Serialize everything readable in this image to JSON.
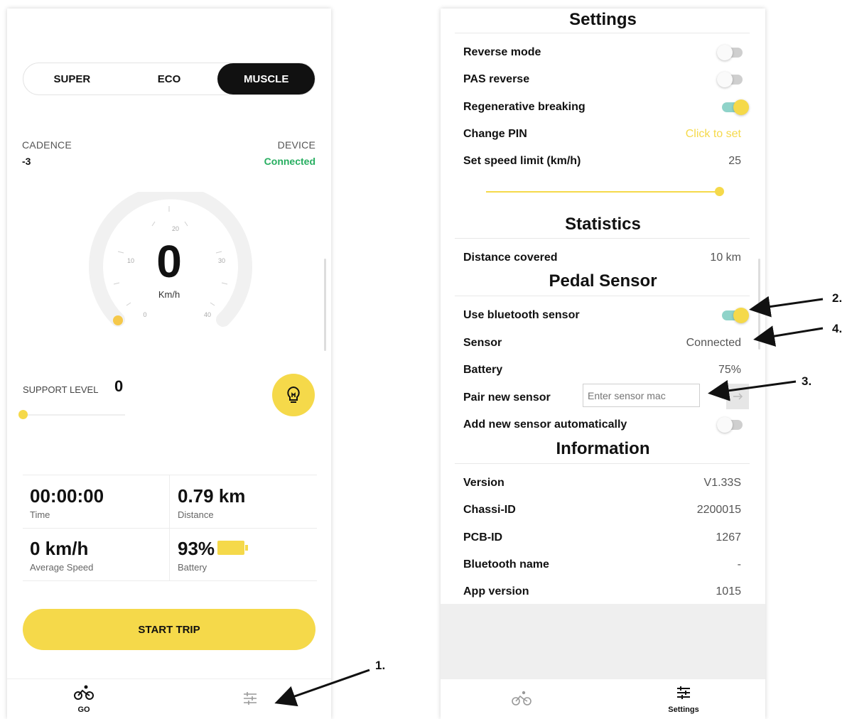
{
  "go_screen": {
    "modes": [
      {
        "label": "SUPER",
        "active": false
      },
      {
        "label": "ECO",
        "active": false
      },
      {
        "label": "MUSCLE",
        "active": true
      }
    ],
    "cadence": {
      "label": "CADENCE",
      "value": "-3"
    },
    "device": {
      "label": "DEVICE",
      "value": "Connected",
      "color": "#27ae60"
    },
    "speedometer": {
      "speed": "0",
      "unit": "Km/h",
      "ticks": [
        "0",
        "10",
        "20",
        "30",
        "40"
      ],
      "level_fraction": 0
    },
    "support_level": {
      "label": "SUPPORT LEVEL",
      "value": "0",
      "level_fraction": 0
    },
    "light_button": {
      "icon": "lightbulb-icon"
    },
    "stats": {
      "time": {
        "value": "00:00:00",
        "label": "Time"
      },
      "distance": {
        "value": "0.79 km",
        "label": "Distance"
      },
      "avg_speed": {
        "value": "0 km/h",
        "label": "Average Speed"
      },
      "battery": {
        "value": "93%",
        "label": "Battery",
        "icon": "battery-icon"
      }
    },
    "start_button": "START TRIP",
    "nav": {
      "go": {
        "label": "GO",
        "icon": "bicycle-icon"
      },
      "settings": {
        "label": "",
        "icon": "sliders-icon"
      }
    }
  },
  "settings_screen": {
    "title": "Settings",
    "settings": {
      "reverse_mode": {
        "label": "Reverse mode",
        "on": false
      },
      "pas_reverse": {
        "label": "PAS reverse",
        "on": false
      },
      "regen": {
        "label": "Regenerative breaking",
        "on": true
      },
      "change_pin": {
        "label": "Change PIN",
        "value": "Click to set"
      },
      "speed_limit": {
        "label": "Set speed limit (km/h)",
        "value": "25",
        "slider_fraction": 1.0
      }
    },
    "statistics": {
      "title": "Statistics",
      "distance": {
        "label": "Distance covered",
        "value": "10 km"
      }
    },
    "pedal_sensor": {
      "title": "Pedal Sensor",
      "use_bluetooth": {
        "label": "Use bluetooth sensor",
        "on": true
      },
      "sensor": {
        "label": "Sensor",
        "value": "Connected"
      },
      "battery": {
        "label": "Battery",
        "value": "75%"
      },
      "pair": {
        "label": "Pair new sensor",
        "placeholder": "Enter sensor mac",
        "button_icon": "arrow-right-icon"
      },
      "auto_add": {
        "label": "Add new sensor automatically",
        "on": false
      }
    },
    "information": {
      "title": "Information",
      "version": {
        "label": "Version",
        "value": "V1.33S"
      },
      "chassi": {
        "label": "Chassi-ID",
        "value": "2200015"
      },
      "pcb": {
        "label": "PCB-ID",
        "value": "1267"
      },
      "bt_name": {
        "label": "Bluetooth name",
        "value": "-"
      },
      "app_version": {
        "label": "App version",
        "value": "1015"
      }
    },
    "nav": {
      "go": {
        "label": "",
        "icon": "bicycle-icon"
      },
      "settings": {
        "label": "Settings",
        "icon": "sliders-icon"
      }
    }
  },
  "annotations": [
    "1.",
    "2.",
    "3.",
    "4."
  ],
  "colors": {
    "accent": "#f5d94a",
    "pin_link": "#f5d94a",
    "toggle_on_track": "#8fd3c9"
  }
}
